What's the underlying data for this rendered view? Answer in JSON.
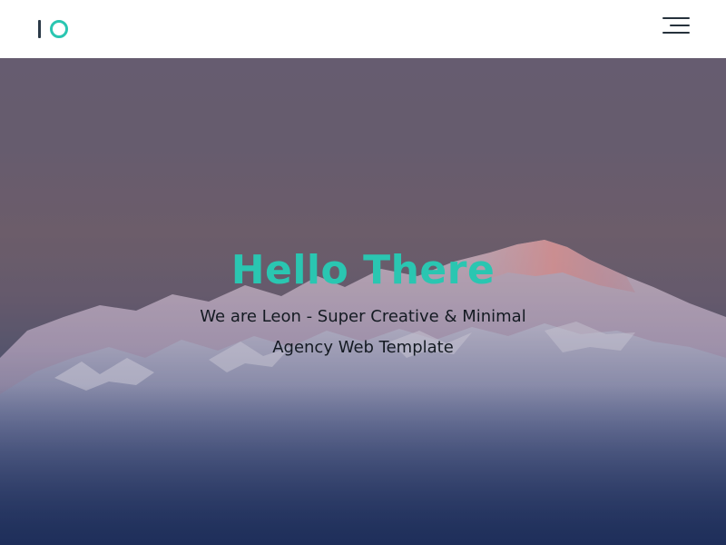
{
  "navbar": {
    "logo_alt": "IO",
    "menu_icon": "hamburger-menu-icon"
  },
  "hero": {
    "title": "Hello There",
    "subtitle": "We are Leon - Super Creative & Minimal Agency Web Template",
    "background": "snowy mountain range at dusk"
  },
  "colors": {
    "accent": "#2ac6b1",
    "logo_dark": "#2b3a48",
    "menu_lines": "#26323c",
    "subtitle_text": "#141a22",
    "nav_background": "#ffffff"
  }
}
